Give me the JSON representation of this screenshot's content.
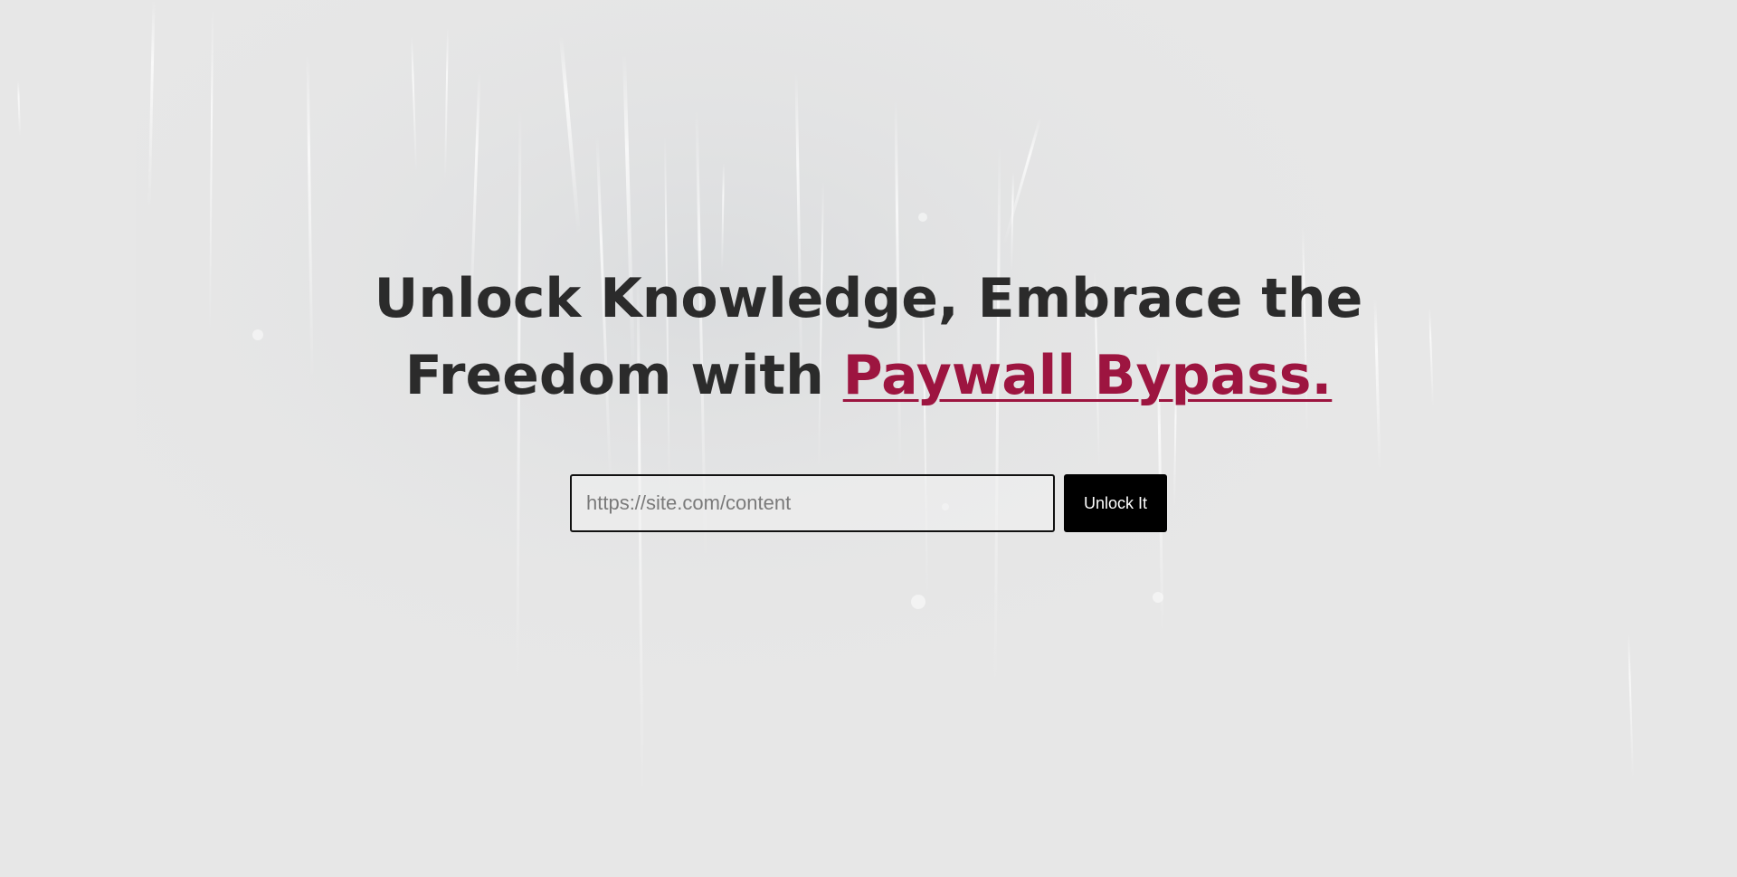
{
  "hero": {
    "headline_line1": "Unlock Knowledge, Embrace the",
    "headline_line2_prefix": "Freedom with",
    "brand_link": "Paywall Bypass."
  },
  "form": {
    "url_placeholder": "https://site.com/content",
    "url_value": "",
    "submit_label": "Unlock It"
  },
  "colors": {
    "background": "#e7e7e7",
    "headline": "#2b2b2b",
    "accent": "#9d1540",
    "button": "#000000",
    "button_text": "#ffffff"
  }
}
